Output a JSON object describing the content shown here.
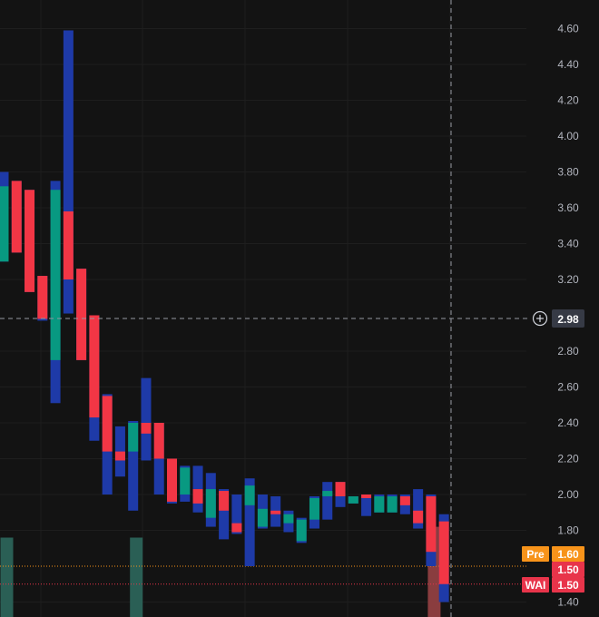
{
  "chart_data": {
    "type": "candlestick",
    "title": "",
    "xlabel": "",
    "ylabel": "",
    "ylim": [
      1.36,
      4.66
    ],
    "y_ticks": [
      "4.60",
      "4.40",
      "4.20",
      "4.00",
      "3.80",
      "3.60",
      "3.40",
      "3.20",
      "2.80",
      "2.60",
      "2.40",
      "2.20",
      "2.00",
      "1.80",
      "1.40"
    ],
    "grid": true,
    "crosshair": {
      "price_label": "2.98"
    },
    "markers": [
      {
        "label": "Pre",
        "value_label": "1.60",
        "color": "#f7931a"
      },
      {
        "label": "",
        "value_label": "1.50",
        "color": "#e8344a"
      },
      {
        "label": "WAI",
        "value_label": "1.50",
        "color": "#e8344a"
      }
    ],
    "colors": {
      "up": "#089981",
      "down": "#f23645",
      "overlay": "#1e3aa8",
      "background": "#131313"
    },
    "candles": [
      {
        "color": "up",
        "o": 3.3,
        "c": 3.72,
        "h": 3.8,
        "l": 3.3
      },
      {
        "color": "down",
        "o": 3.75,
        "c": 3.35,
        "h": 3.75,
        "l": 3.35
      },
      {
        "color": "down",
        "o": 3.7,
        "c": 3.13,
        "h": 3.7,
        "l": 3.13
      },
      {
        "color": "down",
        "o": 3.22,
        "c": 2.98,
        "h": 3.22,
        "l": 2.97
      },
      {
        "color": "up",
        "o": 2.75,
        "c": 3.7,
        "h": 3.75,
        "l": 2.51
      },
      {
        "color": "down",
        "o": 3.58,
        "c": 3.2,
        "h": 4.59,
        "l": 3.01
      },
      {
        "color": "down",
        "o": 3.26,
        "c": 2.75,
        "h": 3.26,
        "l": 2.75
      },
      {
        "color": "down",
        "o": 3.0,
        "c": 2.43,
        "h": 3.0,
        "l": 2.3
      },
      {
        "color": "down",
        "o": 2.55,
        "c": 2.24,
        "h": 2.56,
        "l": 2.0
      },
      {
        "color": "down",
        "o": 2.24,
        "c": 2.19,
        "h": 2.38,
        "l": 2.1
      },
      {
        "color": "up",
        "o": 2.24,
        "c": 2.4,
        "h": 2.41,
        "l": 1.91
      },
      {
        "color": "down",
        "o": 2.4,
        "c": 2.34,
        "h": 2.65,
        "l": 2.19
      },
      {
        "color": "down",
        "o": 2.4,
        "c": 2.2,
        "h": 2.4,
        "l": 2.0
      },
      {
        "color": "down",
        "o": 2.2,
        "c": 1.96,
        "h": 2.2,
        "l": 1.95
      },
      {
        "color": "up",
        "o": 2.0,
        "c": 2.15,
        "h": 2.16,
        "l": 1.96
      },
      {
        "color": "down",
        "o": 2.03,
        "c": 1.95,
        "h": 2.16,
        "l": 1.9
      },
      {
        "color": "up",
        "o": 1.87,
        "c": 2.03,
        "h": 2.12,
        "l": 1.82
      },
      {
        "color": "down",
        "o": 2.02,
        "c": 1.91,
        "h": 2.03,
        "l": 1.75
      },
      {
        "color": "down",
        "o": 1.84,
        "c": 1.79,
        "h": 2.0,
        "l": 1.78
      },
      {
        "color": "up",
        "o": 1.94,
        "c": 2.05,
        "h": 2.09,
        "l": 1.6
      },
      {
        "color": "up",
        "o": 1.82,
        "c": 1.92,
        "h": 2.0,
        "l": 1.81
      },
      {
        "color": "down",
        "o": 1.91,
        "c": 1.89,
        "h": 1.99,
        "l": 1.82
      },
      {
        "color": "up",
        "o": 1.84,
        "c": 1.89,
        "h": 1.91,
        "l": 1.79
      },
      {
        "color": "up",
        "o": 1.74,
        "c": 1.86,
        "h": 1.87,
        "l": 1.73
      },
      {
        "color": "up",
        "o": 1.86,
        "c": 1.98,
        "h": 1.99,
        "l": 1.81
      },
      {
        "color": "up",
        "o": 1.99,
        "c": 2.02,
        "h": 2.07,
        "l": 1.86
      },
      {
        "color": "down",
        "o": 2.07,
        "c": 1.99,
        "h": 2.07,
        "l": 1.93
      },
      {
        "color": "up",
        "o": 1.95,
        "c": 1.99,
        "h": 1.99,
        "l": 1.95
      },
      {
        "color": "down",
        "o": 2.0,
        "c": 1.98,
        "h": 2.0,
        "l": 1.88
      },
      {
        "color": "up",
        "o": 1.9,
        "c": 1.99,
        "h": 2.0,
        "l": 1.9
      },
      {
        "color": "up",
        "o": 1.9,
        "c": 1.99,
        "h": 2.0,
        "l": 1.9
      },
      {
        "color": "down",
        "o": 1.99,
        "c": 1.94,
        "h": 2.0,
        "l": 1.89
      },
      {
        "color": "down",
        "o": 1.91,
        "c": 1.84,
        "h": 2.03,
        "l": 1.81
      },
      {
        "color": "down",
        "o": 1.99,
        "c": 1.68,
        "h": 2.0,
        "l": 1.6
      },
      {
        "color": "down",
        "o": 1.85,
        "c": 1.5,
        "h": 1.89,
        "l": 1.4
      }
    ],
    "volume": [
      0.55,
      0,
      0,
      0,
      0,
      0,
      0,
      0,
      0,
      0,
      0.55,
      0,
      0,
      0,
      0,
      0,
      0,
      0,
      0,
      0,
      0,
      0,
      0,
      0,
      0,
      0,
      0,
      0,
      0,
      0,
      0,
      0,
      0,
      0.62,
      0
    ]
  }
}
